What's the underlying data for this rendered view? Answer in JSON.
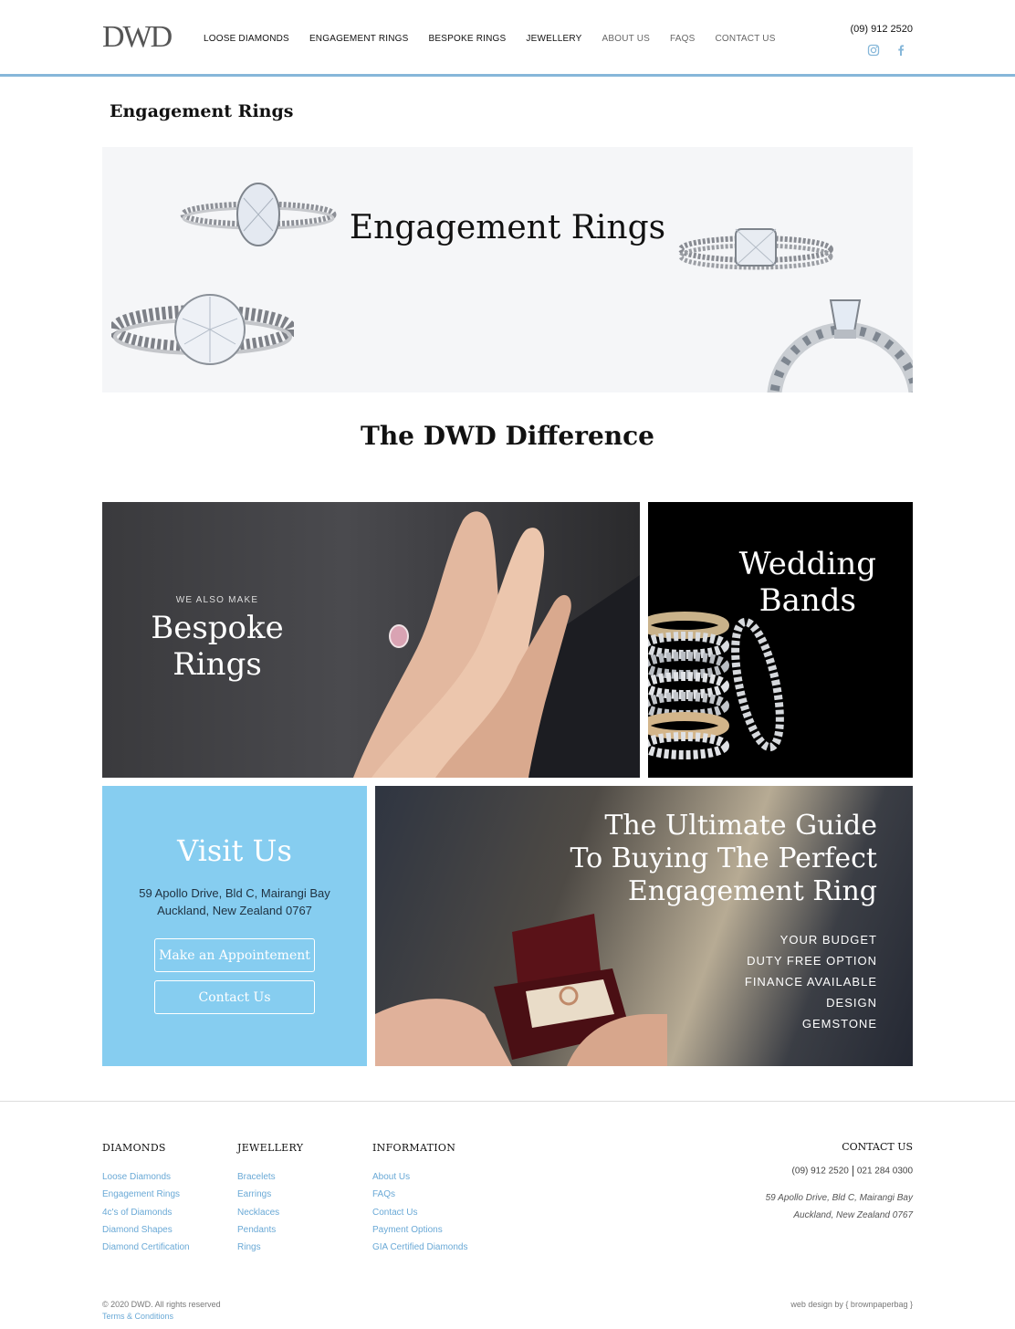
{
  "header": {
    "logo": "DWD",
    "nav": [
      "LOOSE DIAMONDS",
      "ENGAGEMENT RINGS",
      "BESPOKE RINGS",
      "JEWELLERY",
      "ABOUT US",
      "FAQS",
      "CONTACT US"
    ],
    "phone": "(09) 912 2520",
    "social_icons": [
      "instagram-icon",
      "facebook-icon"
    ]
  },
  "page": {
    "heading": "Engagement Rings",
    "hero_title": "Engagement Rings",
    "section_title": "The DWD Difference"
  },
  "tiles": {
    "bespoke": {
      "kicker": "WE ALSO MAKE",
      "line1": "Bespoke",
      "line2": "Rings"
    },
    "wedding": {
      "line1": "Wedding",
      "line2": "Bands"
    },
    "visit": {
      "title": "Visit Us",
      "address1": "59 Apollo Drive, Bld C, Mairangi Bay",
      "address2": "Auckland, New Zealand 0767",
      "appointment_button": "Make an Appointement",
      "contact_button": "Contact Us"
    },
    "guide": {
      "line1": "The Ultimate Guide",
      "line2": "To Buying The Perfect",
      "line3": "Engagement Ring",
      "items": [
        "YOUR BUDGET",
        "DUTY FREE OPTION",
        "FINANCE AVAILABLE",
        "DESIGN",
        "GEMSTONE"
      ]
    }
  },
  "footer": {
    "diamonds": {
      "title": "DIAMONDS",
      "links": [
        "Loose Diamonds",
        "Engagement Rings",
        "4c's of Diamonds",
        "Diamond Shapes",
        "Diamond Certification"
      ]
    },
    "jewellery": {
      "title": "JEWELLERY",
      "links": [
        "Bracelets",
        "Earrings",
        "Necklaces",
        "Pendants",
        "Rings"
      ]
    },
    "information": {
      "title": "INFORMATION",
      "links": [
        "About Us",
        "FAQs",
        "Contact Us",
        "Payment Options",
        "GIA Certified Diamonds"
      ]
    },
    "contact": {
      "title": "CONTACT US",
      "phone1": "(09) 912 2520",
      "phone2": "021 284 0300",
      "address1": "59 Apollo Drive, Bld C, Mairangi Bay",
      "address2": "Auckland, New Zealand 0767"
    },
    "copyright": "© 2020 DWD. All rights reserved",
    "terms": "Terms & Conditions",
    "credit": "web design by { brownpaperbag }"
  },
  "colors": {
    "accent_blue": "#86b7d9",
    "visit_bg": "#86cdf0",
    "link_blue": "#6aa9d6"
  }
}
